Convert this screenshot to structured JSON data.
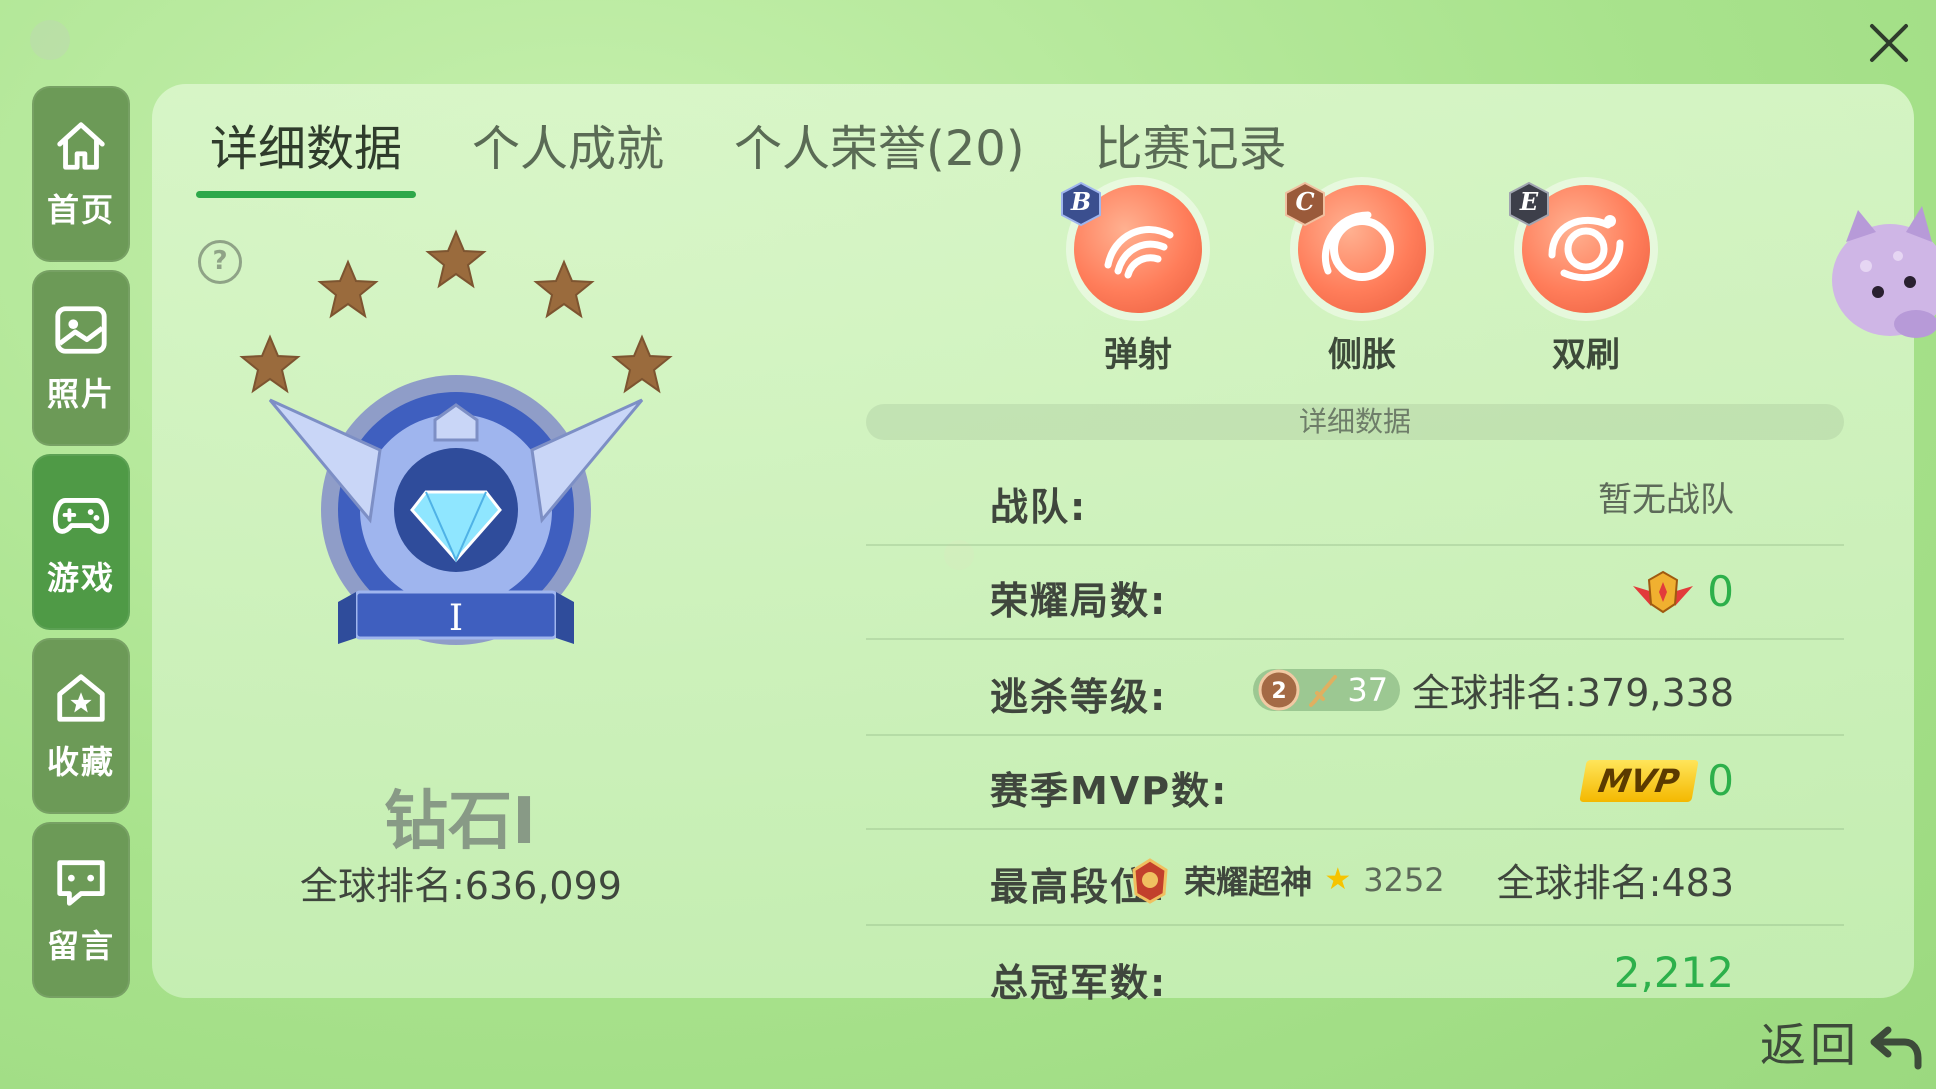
{
  "sidebar": {
    "items": [
      {
        "label": "首页",
        "icon": "home-icon"
      },
      {
        "label": "照片",
        "icon": "photo-icon"
      },
      {
        "label": "游戏",
        "icon": "gamepad-icon"
      },
      {
        "label": "收藏",
        "icon": "star-house-icon"
      },
      {
        "label": "留言",
        "icon": "message-icon"
      }
    ],
    "active_index": 2
  },
  "tabs": [
    {
      "label": "详细数据",
      "active": true
    },
    {
      "label": "个人成就",
      "active": false
    },
    {
      "label": "个人荣誉(20)",
      "active": false
    },
    {
      "label": "比赛记录",
      "active": false
    }
  ],
  "rank": {
    "name": "钻石Ⅰ",
    "global_rank": "全球排名:636,099",
    "stars": 5,
    "emblem_tier": "I"
  },
  "skills": [
    {
      "grade": "B",
      "name": "弹射"
    },
    {
      "grade": "C",
      "name": "侧胀"
    },
    {
      "grade": "E",
      "name": "双刷"
    }
  ],
  "stats": {
    "header": "详细数据",
    "team_label": "战队:",
    "team_value": "暂无战队",
    "glory_games_label": "荣耀局数:",
    "glory_games_value": "0",
    "escape_level_label": "逃杀等级:",
    "escape_level_badge": "2",
    "escape_level_value": "37",
    "escape_level_rank": "全球排名:379,338",
    "mvp_label": "赛季MVP数:",
    "mvp_badge": "MVP",
    "mvp_value": "0",
    "highest_rank_label": "最高段位:",
    "highest_rank_name": "荣耀超神",
    "highest_rank_stars": "3252",
    "highest_rank_global": "全球排名:483",
    "champions_label": "总冠军数:",
    "champions_value": "2,212"
  },
  "footer": {
    "back_label": "返回"
  },
  "colors": {
    "accent_green": "#2db04b",
    "sidebar_bg": "#6c9a57",
    "skill_orb": "#ff7d5a",
    "mvp_gold": "#f4b800"
  }
}
